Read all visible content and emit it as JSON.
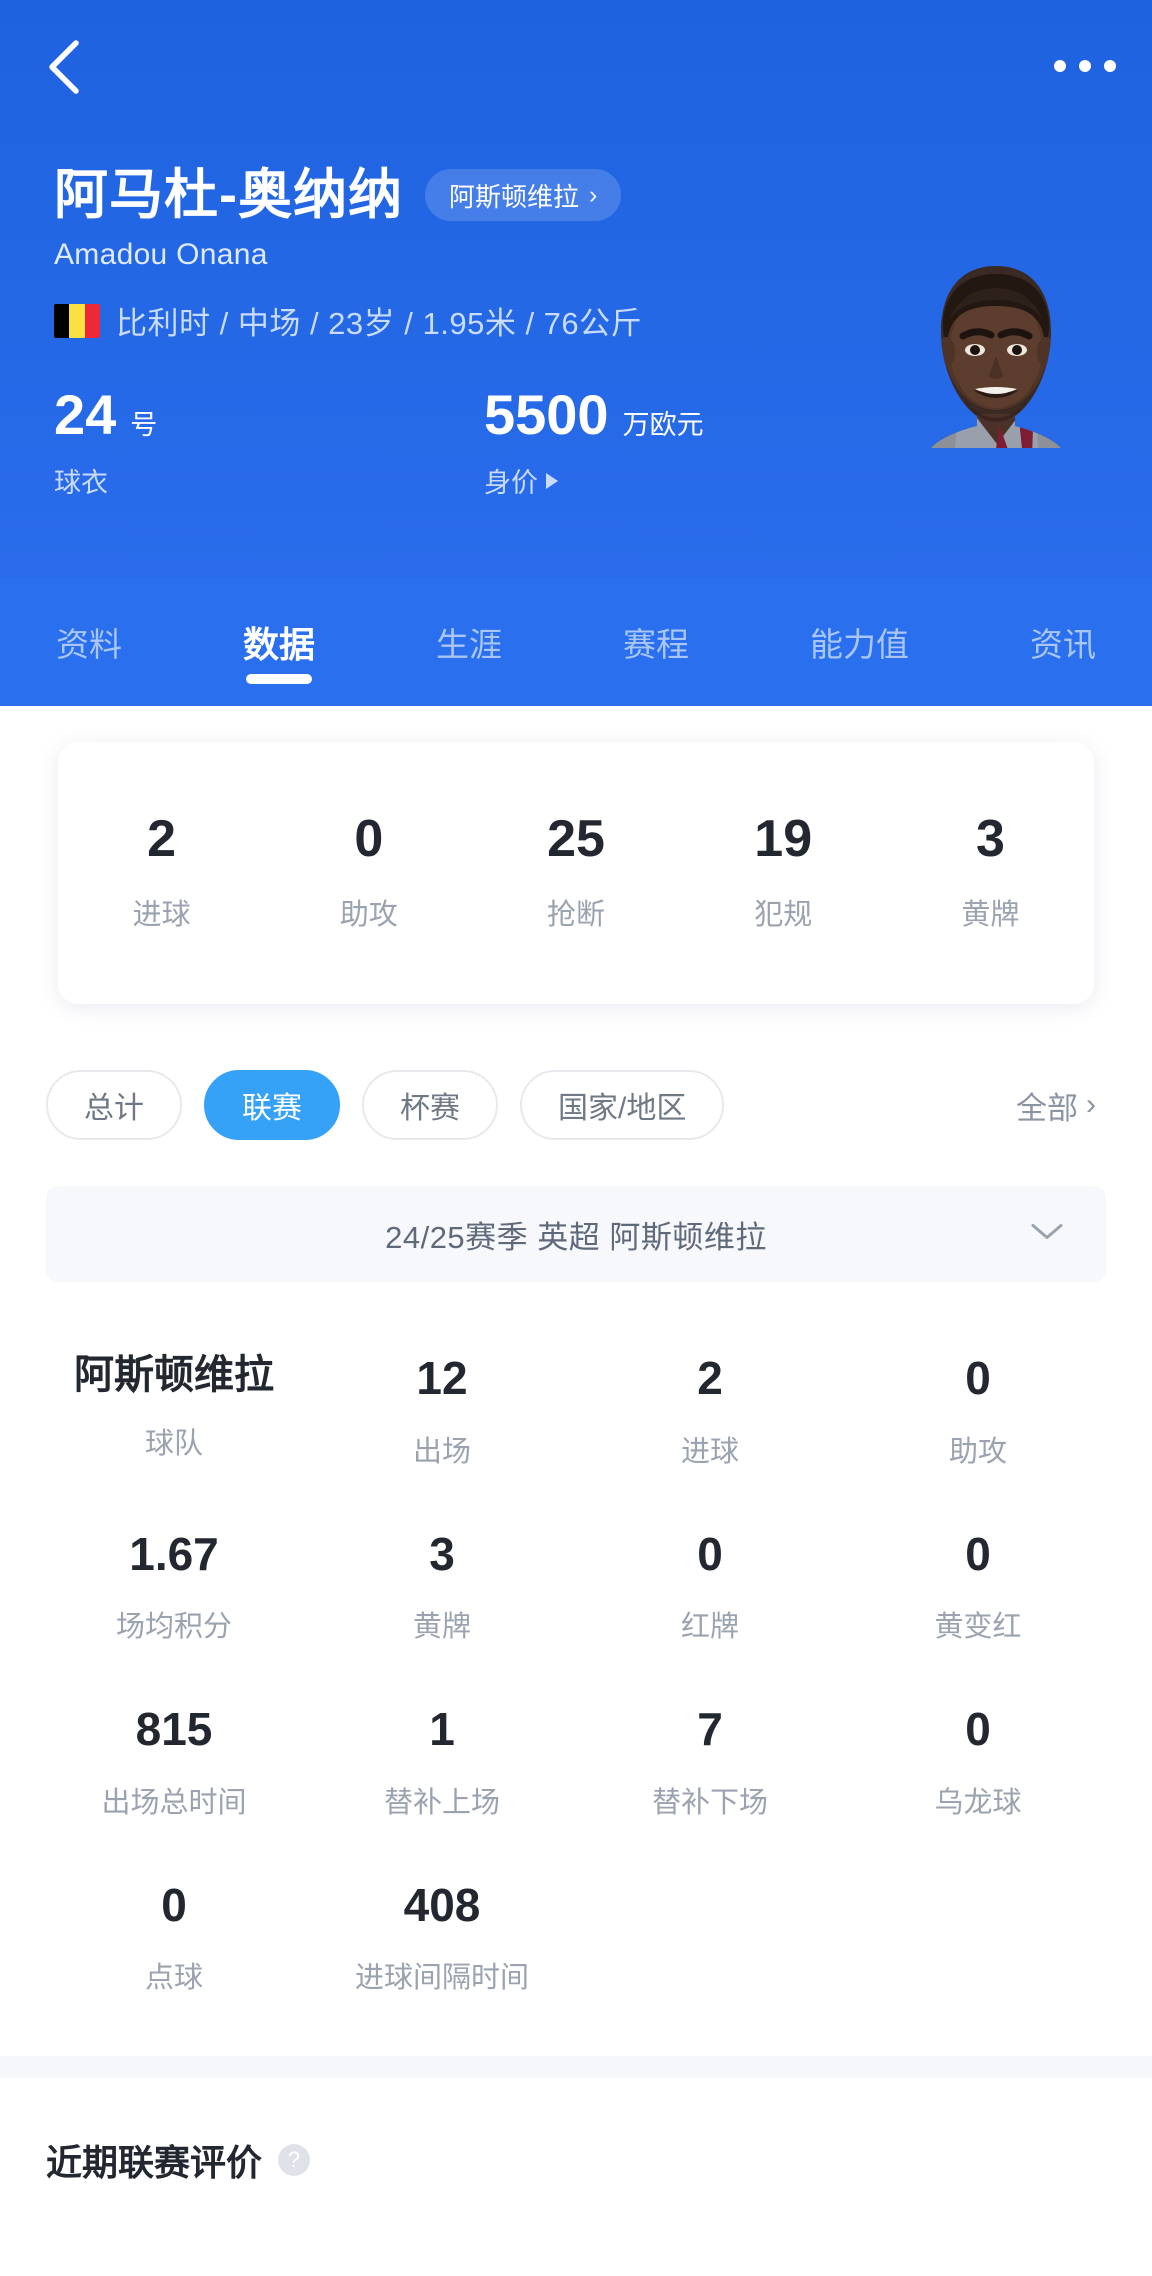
{
  "header": {
    "back_icon": "back-chevron-icon",
    "more_icon": "more-dots-icon",
    "player_name_cn": "阿马杜-奥纳纳",
    "player_name_en": "Amadou Onana",
    "team_pill_label": "阿斯顿维拉",
    "team_pill_chevron": "›",
    "nationality": "比利时",
    "meta_line": "比利时 / 中场 / 23岁 / 1.95米 / 76公斤",
    "flag_colors": [
      "#000000",
      "#FAE042",
      "#ED2939"
    ],
    "jersey_number": "24",
    "jersey_unit": "号",
    "jersey_label": "球衣",
    "market_value": "5500",
    "market_value_unit": "万欧元",
    "market_value_label": "身价",
    "accent_blue": "#1f62e0",
    "tab_bar_blue": "#2a70ee"
  },
  "tabs": [
    {
      "label": "资料",
      "active": false
    },
    {
      "label": "数据",
      "active": true
    },
    {
      "label": "生涯",
      "active": false
    },
    {
      "label": "赛程",
      "active": false
    },
    {
      "label": "能力值",
      "active": false
    },
    {
      "label": "资讯",
      "active": false
    }
  ],
  "summary": [
    {
      "value": "2",
      "label": "进球"
    },
    {
      "value": "0",
      "label": "助攻"
    },
    {
      "value": "25",
      "label": "抢断"
    },
    {
      "value": "19",
      "label": "犯规"
    },
    {
      "value": "3",
      "label": "黄牌"
    }
  ],
  "filter_chips": [
    {
      "label": "总计",
      "active": false
    },
    {
      "label": "联赛",
      "active": true
    },
    {
      "label": "杯赛",
      "active": false
    },
    {
      "label": "国家/地区",
      "active": false
    }
  ],
  "filter_all": {
    "label": "全部",
    "chevron": "›"
  },
  "season_selector": {
    "text": "24/25赛季 英超 阿斯顿维拉",
    "chevron_icon": "chevron-down-icon"
  },
  "detail_stats": [
    {
      "value": "阿斯顿维拉",
      "label": "球队",
      "is_team": true
    },
    {
      "value": "12",
      "label": "出场"
    },
    {
      "value": "2",
      "label": "进球"
    },
    {
      "value": "0",
      "label": "助攻"
    },
    {
      "value": "1.67",
      "label": "场均积分"
    },
    {
      "value": "3",
      "label": "黄牌"
    },
    {
      "value": "0",
      "label": "红牌"
    },
    {
      "value": "0",
      "label": "黄变红"
    },
    {
      "value": "815",
      "label": "出场总时间"
    },
    {
      "value": "1",
      "label": "替补上场"
    },
    {
      "value": "7",
      "label": "替补下场"
    },
    {
      "value": "0",
      "label": "乌龙球"
    },
    {
      "value": "0",
      "label": "点球"
    },
    {
      "value": "408",
      "label": "进球间隔时间"
    }
  ],
  "bottom_section": {
    "title": "近期联赛评价",
    "help_icon_label": "?"
  },
  "colors": {
    "chip_active": "#36a2f7",
    "card_bg": "#ffffff",
    "page_bg": "#ffffff",
    "band": "#f5f7fa",
    "label_gray": "#9aa3af",
    "value_dark": "#232830"
  }
}
